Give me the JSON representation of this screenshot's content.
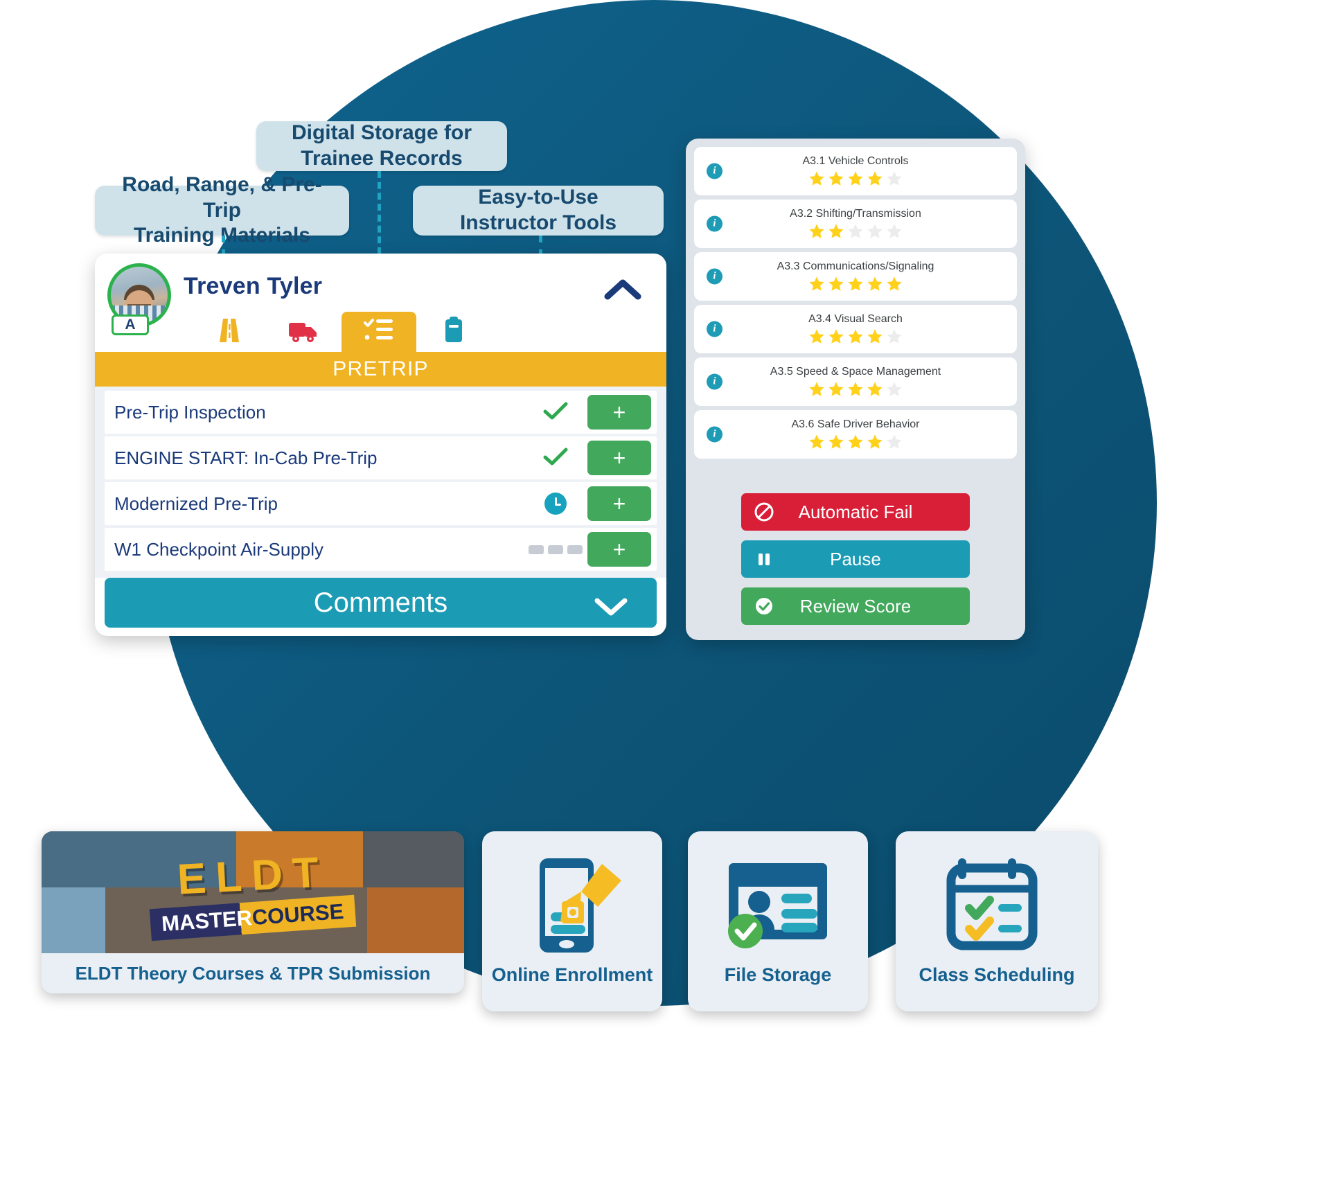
{
  "theme": {
    "circle_blue": "#0d5a82",
    "callout_bg": "#cfe2ea",
    "callout_text": "#174a6e",
    "accent_yellow": "#f0b323",
    "accent_teal": "#1c9bb5",
    "accent_green": "#41a85c",
    "accent_red": "#d81f37",
    "navy": "#1b3a7a"
  },
  "callouts": [
    {
      "id": "digital-storage",
      "line1": "Digital Storage for",
      "line2": "Trainee Records"
    },
    {
      "id": "training-materials",
      "line1": "Road, Range, & Pre-Trip",
      "line2": "Training Materials"
    },
    {
      "id": "instructor-tools",
      "line1": "Easy-to-Use",
      "line2": "Instructor Tools"
    }
  ],
  "trainee_panel": {
    "name": "Treven Tyler",
    "grade_badge": "A",
    "collapse_icon": "chevron-up-icon",
    "tabs": [
      {
        "id": "road",
        "icon": "road-icon",
        "active": false
      },
      {
        "id": "truck",
        "icon": "truck-icon",
        "active": false
      },
      {
        "id": "checklist",
        "icon": "checklist-icon",
        "active": true
      },
      {
        "id": "clipboard",
        "icon": "clipboard-icon",
        "active": false
      }
    ],
    "section_title": "PRETRIP",
    "tasks": [
      {
        "label": "Pre-Trip Inspection",
        "status": "check",
        "action": "+"
      },
      {
        "label": "ENGINE START: In-Cab Pre-Trip",
        "status": "check",
        "action": "+"
      },
      {
        "label": "Modernized Pre-Trip",
        "status": "clock",
        "action": "+"
      },
      {
        "label": "W1 Checkpoint Air-Supply",
        "status": "dots",
        "action": "+"
      }
    ],
    "comments_label": "Comments",
    "comments_icon": "chevron-down-icon"
  },
  "score_panel": {
    "ratings": [
      {
        "label": "A3.1 Vehicle Controls",
        "stars": 4,
        "max": 5,
        "info_icon": "info-icon"
      },
      {
        "label": "A3.2 Shifting/Transmission",
        "stars": 2,
        "max": 5,
        "info_icon": "info-icon"
      },
      {
        "label": "A3.3 Communications/Signaling",
        "stars": 5,
        "max": 5,
        "info_icon": "info-icon"
      },
      {
        "label": "A3.4 Visual Search",
        "stars": 4,
        "max": 5,
        "info_icon": "info-icon"
      },
      {
        "label": "A3.5 Speed & Space Management",
        "stars": 4,
        "max": 5,
        "info_icon": "info-icon"
      },
      {
        "label": "A3.6 Safe Driver Behavior",
        "stars": 4,
        "max": 5,
        "info_icon": "info-icon"
      }
    ],
    "actions": [
      {
        "id": "automatic-fail",
        "label": "Automatic Fail",
        "icon": "no-entry-icon",
        "color": "#d81f37"
      },
      {
        "id": "pause",
        "label": "Pause",
        "icon": "pause-icon",
        "color": "#1c9bb5"
      },
      {
        "id": "review-score",
        "label": "Review Score",
        "icon": "check-circle-icon",
        "color": "#41a85c"
      }
    ]
  },
  "feature_cards": [
    {
      "id": "eldt",
      "caption": "ELDT Theory Courses & TPR Submission",
      "thumb_word": "ELDT",
      "thumb_sub_a": "MASTER",
      "thumb_sub_b": "COURSE"
    },
    {
      "id": "enroll",
      "caption": "Online Enrollment",
      "icon": "phone-signature-icon"
    },
    {
      "id": "storage",
      "caption": "File Storage",
      "icon": "id-card-check-icon"
    },
    {
      "id": "class",
      "caption": "Class Scheduling",
      "icon": "calendar-checklist-icon"
    }
  ]
}
